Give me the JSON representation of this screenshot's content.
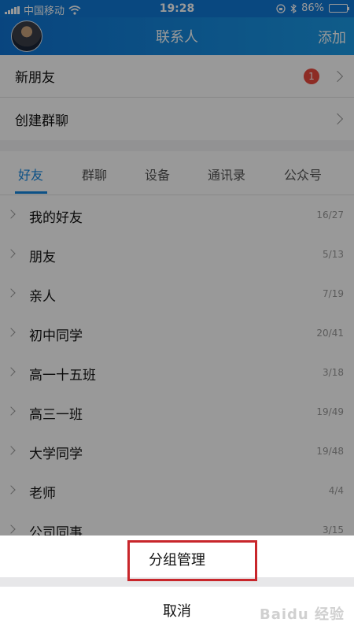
{
  "status_bar": {
    "carrier": "中国移动",
    "time": "19:28",
    "battery": "86%",
    "battery_level": 0.86
  },
  "header": {
    "title": "联系人",
    "add_label": "添加"
  },
  "top_items": [
    {
      "label": "新朋友",
      "badge": "1"
    },
    {
      "label": "创建群聊"
    }
  ],
  "tabs": [
    "好友",
    "群聊",
    "设备",
    "通讯录",
    "公众号"
  ],
  "groups": [
    {
      "name": "我的好友",
      "count": "16/27"
    },
    {
      "name": "朋友",
      "count": "5/13"
    },
    {
      "name": "亲人",
      "count": "7/19"
    },
    {
      "name": "初中同学",
      "count": "20/41"
    },
    {
      "name": "高一十五班",
      "count": "3/18"
    },
    {
      "name": "高三一班",
      "count": "19/49"
    },
    {
      "name": "大学同学",
      "count": "19/48"
    },
    {
      "name": "老师",
      "count": "4/4"
    },
    {
      "name": "公司同事",
      "count": "3/15"
    }
  ],
  "action_sheet": {
    "manage_label": "分组管理",
    "cancel_label": "取消"
  },
  "watermark": "Baidu 经验",
  "colors": {
    "accent": "#1587e0",
    "header": "#0f78d6",
    "badge": "#ec4a3e",
    "highlight": "#c8262b"
  }
}
